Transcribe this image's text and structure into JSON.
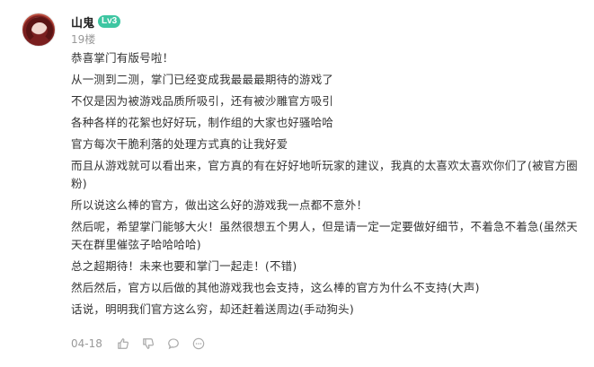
{
  "user": {
    "name": "山鬼",
    "level": "Lv3",
    "floor": "19楼"
  },
  "post": {
    "lines": [
      "恭喜掌门有版号啦！",
      "从一测到二测，掌门已经变成我最最最期待的游戏了",
      "不仅是因为被游戏品质所吸引，还有被沙雕官方吸引",
      "各种各样的花絮也好好玩，制作组的大家也好骚哈哈",
      "官方每次干脆利落的处理方式真的让我好爱",
      "而且从游戏就可以看出来，官方真的有在好好地听玩家的建议，我真的太喜欢太喜欢你们了(被官方圈粉)",
      "所以说这么棒的官方，做出这么好的游戏我一点都不意外！",
      "然后呢，希望掌门能够大火！虽然很想五个男人，但是请一定一定要做好细节，不着急不着急(虽然天天在群里催弦子哈哈哈哈)",
      "总之超期待！未来也要和掌门一起走！(不错)",
      "然后然后，官方以后做的其他游戏我也会支持，这么棒的官方为什么不支持(大声)",
      "话说，明明我们官方这么穷，却还赶着送周边(手动狗头)"
    ],
    "date": "04-18"
  },
  "actions": [
    {
      "icon": "thumbs-up-icon"
    },
    {
      "icon": "thumbs-down-icon"
    },
    {
      "icon": "comment-icon"
    },
    {
      "icon": "more-icon"
    }
  ],
  "colors": {
    "badge": "#3ec6a2",
    "meta_text": "#999999",
    "body_text": "#333333"
  }
}
